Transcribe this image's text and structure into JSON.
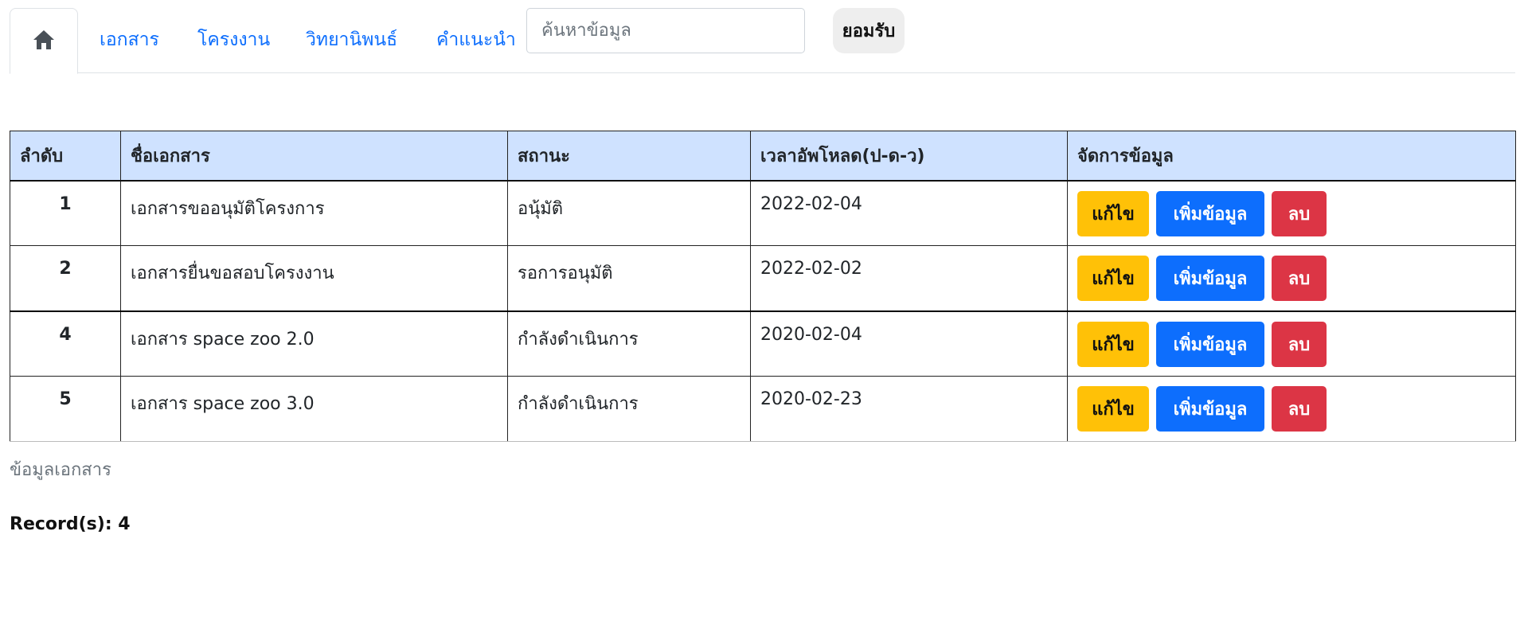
{
  "nav": {
    "home_icon": "home-icon",
    "links": [
      "เอกสาร",
      "โครงงาน",
      "วิทยานิพนธ์",
      "คำแนะนำ"
    ],
    "search_placeholder": "ค้นหาข้อมูล",
    "search_value": "",
    "accept_label": "ยอมรับ"
  },
  "colors": {
    "primary": "#0d6efd",
    "warning": "#ffc107",
    "danger": "#dc3545",
    "header_bg": "#cfe2ff"
  },
  "table": {
    "headers": [
      "ลำดับ",
      "ชื่อเอกสาร",
      "สถานะ",
      "เวลาอัพโหลด(ป-ด-ว)",
      "จัดการข้อมูล"
    ],
    "rows": [
      {
        "no": "1",
        "name": "เอกสารขออนุมัติโครงการ",
        "status": "อนุ้มัติ",
        "uploaded": "2022-02-04"
      },
      {
        "no": "2",
        "name": "เอกสารยื่นขอสอบโครงงาน",
        "status": "รอการอนุมัติ",
        "uploaded": "2022-02-02"
      },
      {
        "no": "4",
        "name": "เอกสาร space zoo 2.0",
        "status": "กำลังดำเนินการ",
        "uploaded": "2020-02-04"
      },
      {
        "no": "5",
        "name": "เอกสาร space zoo 3.0",
        "status": "กำลังดำเนินการ",
        "uploaded": "2020-02-23"
      }
    ],
    "actions": {
      "edit": "แก้ไข",
      "add": "เพิ่มข้อมูล",
      "delete": "ลบ"
    },
    "caption": "ข้อมูลเอกสาร"
  },
  "footer": {
    "record_text": "Record(s): 4"
  }
}
